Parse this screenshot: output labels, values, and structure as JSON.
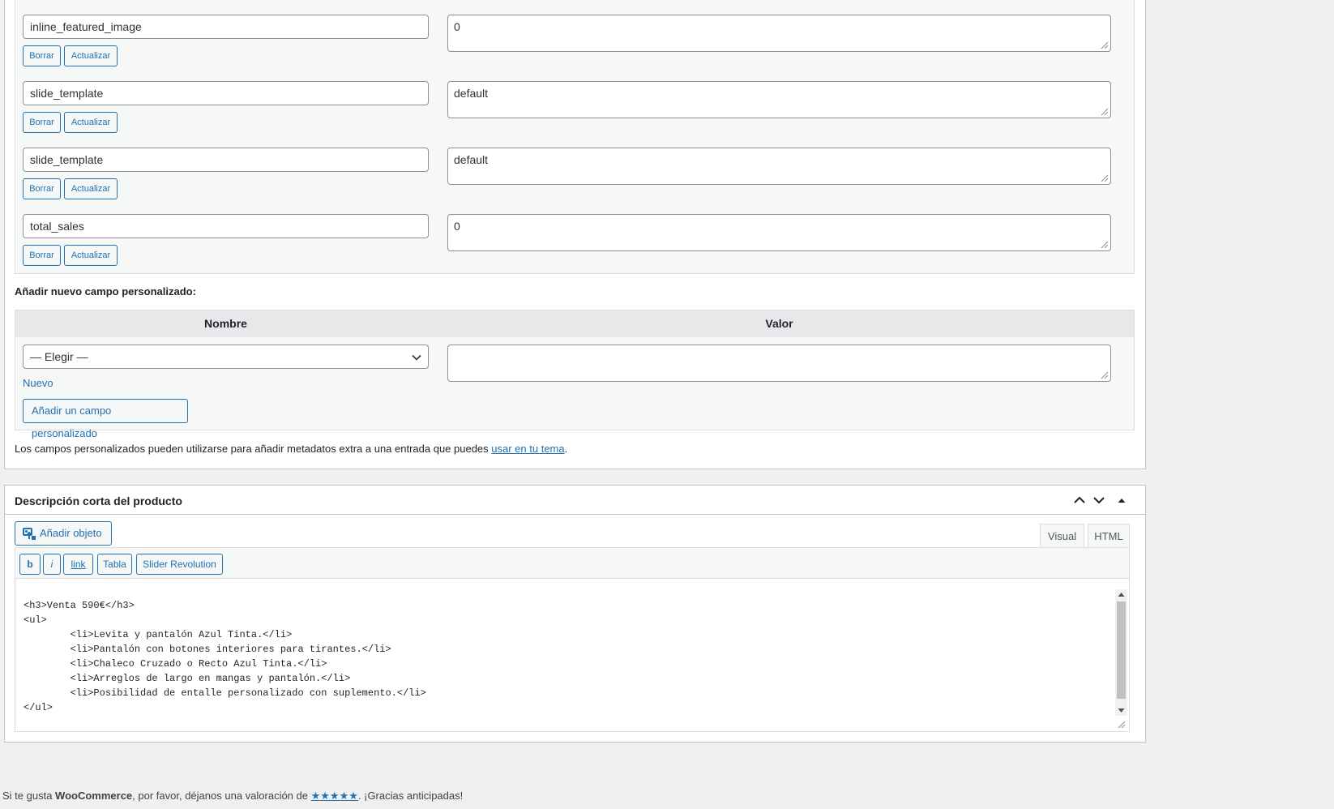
{
  "meta_rows": [
    {
      "key": "inline_featured_image",
      "value": "0"
    },
    {
      "key": "slide_template",
      "value": "default"
    },
    {
      "key": "slide_template",
      "value": "default"
    },
    {
      "key": "total_sales",
      "value": "0"
    }
  ],
  "row_buttons": {
    "delete": "Borrar",
    "update": "Actualizar"
  },
  "add_new": {
    "heading": "Añadir nuevo campo personalizado:",
    "col_name": "Nombre",
    "col_value": "Valor",
    "select_value": "— Elegir —",
    "new_link": "Nuevo",
    "add_button": "Añadir un campo personalizado"
  },
  "custom_fields_note": {
    "text": "Los campos personalizados pueden utilizarse para añadir metadatos extra a una entrada que puedes ",
    "link": "usar en tu tema",
    "end": "."
  },
  "short_desc": {
    "title": "Descripción corta del producto",
    "add_media": "Añadir objeto",
    "tab_visual": "Visual",
    "tab_html": "HTML",
    "quicktags": [
      "b",
      "i",
      "link",
      "Tabla",
      "Slider Revolution"
    ],
    "content_lines": [
      "<h3>Venta 590€</h3>",
      "<ul>",
      "        <li>Levita y pantalón Azul Tinta.</li>",
      "        <li>Pantalón con botones interiores para tirantes.</li>",
      "        <li>Chaleco Cruzado o Recto Azul Tinta.</li>",
      "        <li>Arreglos de largo en mangas y pantalón.</li>",
      "        <li>Posibilidad de entalle personalizado con suplemento.</li>",
      "</ul>"
    ]
  },
  "footer": {
    "prefix": "Si te gusta ",
    "brand": "WooCommerce",
    "middle": ", por favor, déjanos una valoración de ",
    "stars": "★★★★★",
    "suffix": ". ¡Gracias anticipadas!"
  },
  "colors": {
    "accent": "#2271b1",
    "background": "#f0f0f1",
    "panel_border": "#c3c4c7"
  },
  "icons": [
    "resize-grip-icon",
    "chevron-down-icon",
    "chevron-up-icon",
    "triangle-up-icon",
    "media-icon"
  ]
}
